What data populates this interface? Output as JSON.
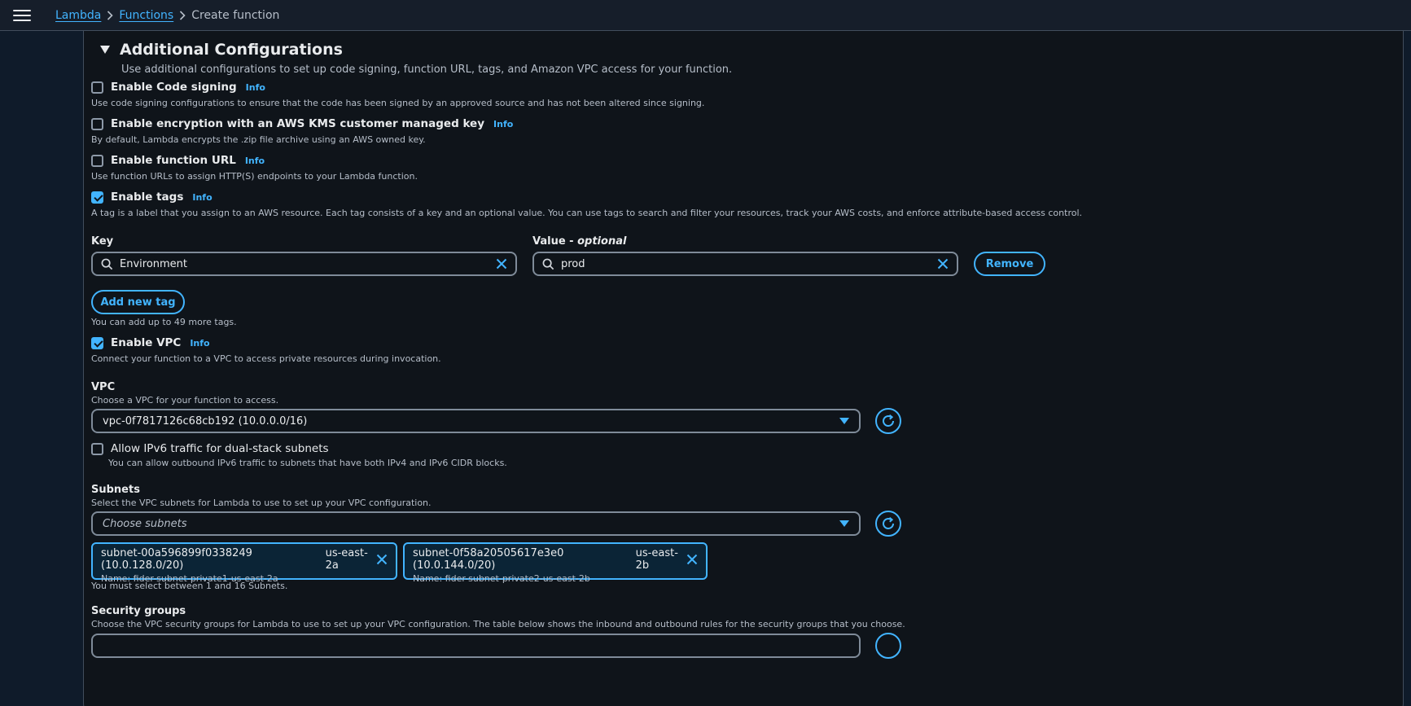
{
  "breadcrumb": {
    "items": [
      "Lambda",
      "Functions"
    ],
    "current": "Create function"
  },
  "section": {
    "title": "Additional Configurations",
    "description": "Use additional configurations to set up code signing, function URL, tags, and Amazon VPC access for your function."
  },
  "info_label": "Info",
  "options": {
    "code_signing": {
      "label": "Enable Code signing",
      "checked": false,
      "description": "Use code signing configurations to ensure that the code has been signed by an approved source and has not been altered since signing."
    },
    "encryption": {
      "label": "Enable encryption with an AWS KMS customer managed key",
      "checked": false,
      "description": "By default, Lambda encrypts the .zip file archive using an AWS owned key."
    },
    "function_url": {
      "label": "Enable function URL",
      "checked": false,
      "description": "Use function URLs to assign HTTP(S) endpoints to your Lambda function."
    },
    "tags": {
      "label": "Enable tags",
      "checked": true,
      "description": "A tag is a label that you assign to an AWS resource. Each tag consists of a key and an optional value. You can use tags to search and filter your resources, track your AWS costs, and enforce attribute-based access control."
    },
    "vpc": {
      "label": "Enable VPC",
      "checked": true,
      "description": "Connect your function to a VPC to access private resources during invocation."
    }
  },
  "tags": {
    "key_label": "Key",
    "value_label": "Value - ",
    "value_label_optional": "optional",
    "key_value": "Environment",
    "value_value": "prod",
    "remove_label": "Remove",
    "add_label": "Add new tag",
    "limit_text": "You can add up to 49 more tags."
  },
  "vpc": {
    "label": "VPC",
    "description": "Choose a VPC for your function to access.",
    "selected": "vpc-0f7817126c68cb192 (10.0.0.0/16)",
    "ipv6": {
      "label": "Allow IPv6 traffic for dual-stack subnets",
      "checked": false,
      "description": "You can allow outbound IPv6 traffic to subnets that have both IPv4 and IPv6 CIDR blocks."
    }
  },
  "subnets": {
    "label": "Subnets",
    "description": "Select the VPC subnets for Lambda to use to set up your VPC configuration.",
    "placeholder": "Choose subnets",
    "selected": [
      {
        "id": "subnet-00a596899f0338249 (10.0.128.0/20)",
        "az": "us-east-2a",
        "name": "Name: fider-subnet-private1-us-east-2a"
      },
      {
        "id": "subnet-0f58a20505617e3e0 (10.0.144.0/20)",
        "az": "us-east-2b",
        "name": "Name: fider-subnet-private2-us-east-2b"
      }
    ],
    "hint": "You must select between 1 and 16 Subnets."
  },
  "security_groups": {
    "label": "Security groups",
    "description": "Choose the VPC security groups for Lambda to use to set up your VPC configuration. The table below shows the inbound and outbound rules for the security groups that you choose."
  },
  "colors": {
    "accent": "#42b4ff",
    "background": "#0f141a",
    "border": "#7f8b99"
  }
}
